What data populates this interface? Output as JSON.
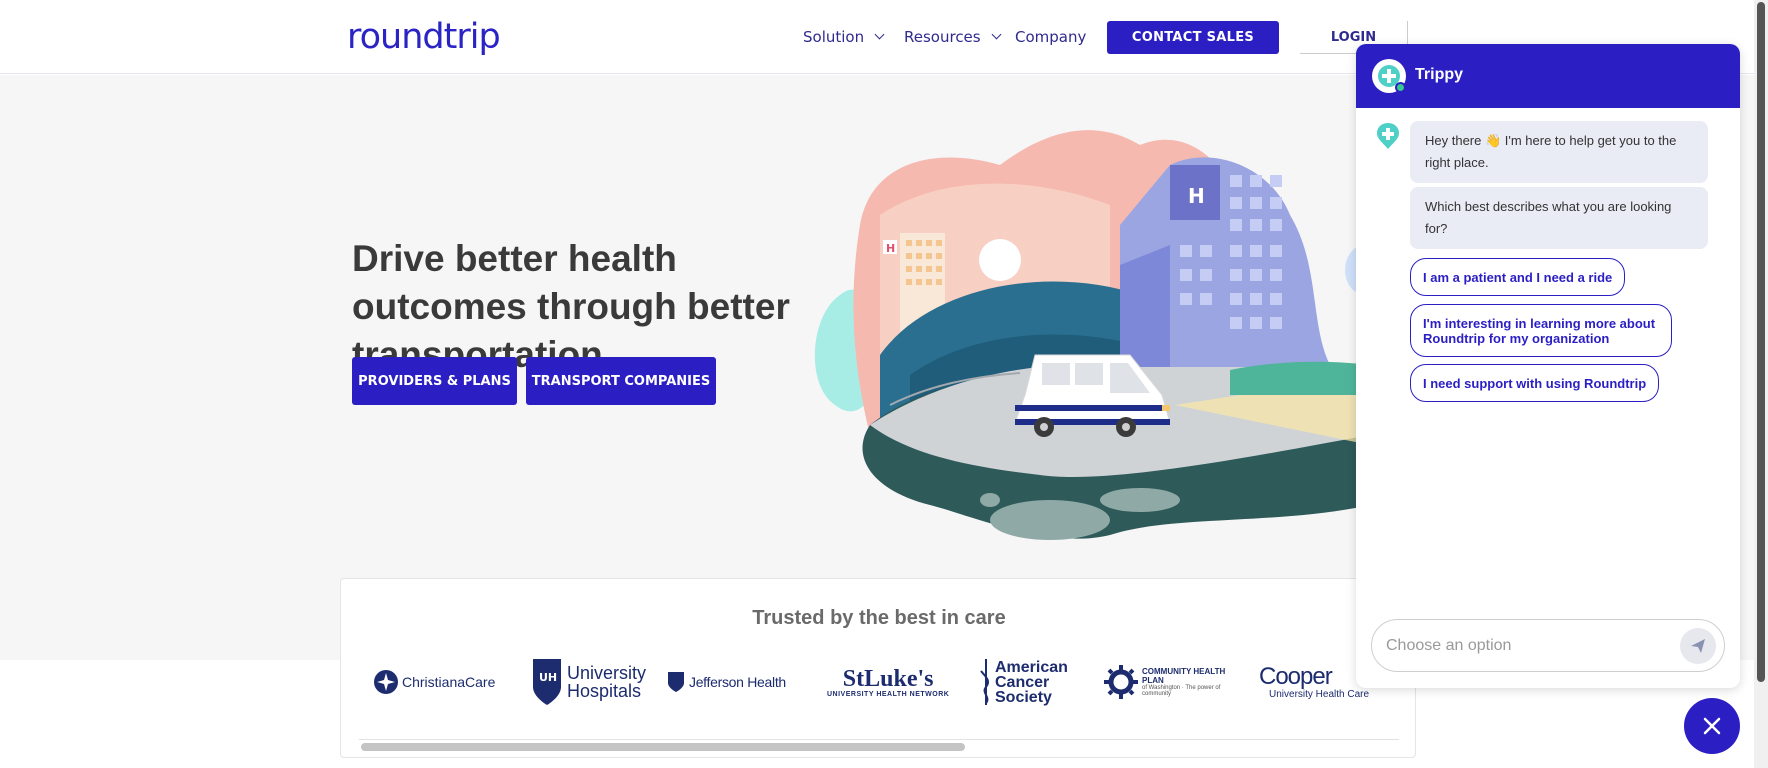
{
  "header": {
    "logo": "roundtrip",
    "nav": [
      {
        "label": "Solution"
      },
      {
        "label": "Resources"
      },
      {
        "label": "Company"
      }
    ],
    "contact_label": "CONTACT SALES",
    "login_label": "LOGIN"
  },
  "hero": {
    "title": "Drive better health outcomes through better transportation.",
    "buttons": [
      {
        "label": "PROVIDERS & PLANS"
      },
      {
        "label": "TRANSPORT COMPANIES"
      }
    ]
  },
  "trusted": {
    "title": "Trusted by the best in care",
    "logos": [
      {
        "text": "ChristianaCare",
        "icon": "star-burst-icon"
      },
      {
        "text": "University Hospitals",
        "icon": "uh-shield-icon"
      },
      {
        "text": "Jefferson Health",
        "icon": "jefferson-shield-icon"
      },
      {
        "text": "StLuke's",
        "subtext": "UNIVERSITY HEALTH NETWORK"
      },
      {
        "text": "American Cancer Society",
        "icon": "sword-icon"
      },
      {
        "text": "COMMUNITY HEALTH PLAN",
        "subtext": "of Washington · The power of community",
        "icon": "sun-icon"
      },
      {
        "text": "Cooper",
        "subtext": "University Health Care"
      }
    ]
  },
  "chat": {
    "bot_name": "Trippy",
    "messages": [
      {
        "text": "Hey there 👋 I'm here to help get you to the right place."
      },
      {
        "text": "Which best describes what you are looking for?"
      }
    ],
    "options": [
      {
        "label": "I am a patient and I need a ride"
      },
      {
        "label": "I'm interesting in learning more about Roundtrip for my organization"
      },
      {
        "label": "I need support with using Roundtrip"
      }
    ],
    "input_placeholder": "Choose an option"
  },
  "colors": {
    "brand": "#2b1fc4",
    "hero_bg": "#f6f6f6",
    "chat_bubble": "#e9ecf5"
  }
}
